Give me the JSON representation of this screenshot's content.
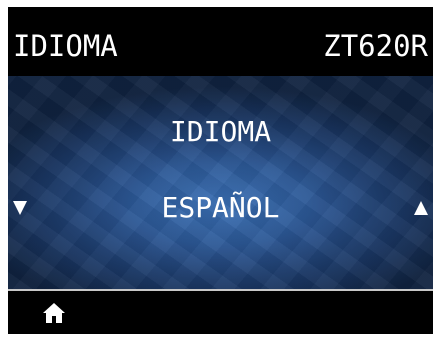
{
  "header": {
    "left_title": "IDIOMA",
    "right_title": "ZT620R"
  },
  "setting": {
    "title": "IDIOMA",
    "value": "ESPAÑOL"
  },
  "icons": {
    "prev": "down-arrow-icon",
    "next": "up-arrow-icon",
    "home": "home-icon"
  },
  "colors": {
    "background": "#000000",
    "panel_center": "#3a6fb4",
    "panel_edge": "#10223f",
    "text": "#ffffff",
    "divider": "#c8c8c8"
  }
}
